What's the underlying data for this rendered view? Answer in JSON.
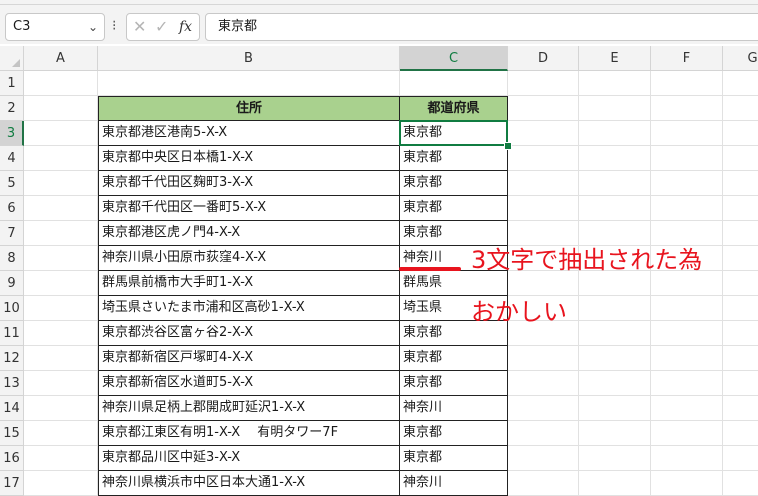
{
  "formula_bar": {
    "name_box": "C3",
    "chevron": "⌄",
    "dots": "⁝",
    "cancel_symbol": "✕",
    "enter_symbol": "✓",
    "fx_symbol": "fx",
    "formula": "東京都"
  },
  "columns": [
    "A",
    "B",
    "C",
    "D",
    "E",
    "F",
    "G"
  ],
  "rows": [
    "1",
    "2",
    "3",
    "4",
    "5",
    "6",
    "7",
    "8",
    "9",
    "10",
    "11",
    "12",
    "13",
    "14",
    "15",
    "16",
    "17"
  ],
  "table": {
    "headers": {
      "address": "住所",
      "prefecture": "都道府県"
    },
    "addresses": [
      "東京都港区港南5-X-X",
      "東京都中央区日本橋1-X-X",
      "東京都千代田区麹町3-X-X",
      "東京都千代田区一番町5-X-X",
      "東京都港区虎ノ門4-X-X",
      "神奈川県小田原市荻窪4-X-X",
      "群馬県前橋市大手町1-X-X",
      "埼玉県さいたま市浦和区高砂1-X-X",
      "東京都渋谷区富ヶ谷2-X-X",
      "東京都新宿区戸塚町4-X-X",
      "東京都新宿区水道町5-X-X",
      "神奈川県足柄上郡開成町延沢1-X-X",
      "東京都江東区有明1-X-X　 有明タワー7F",
      "東京都品川区中延3-X-X",
      "神奈川県横浜市中区日本大通1-X-X"
    ],
    "prefectures": [
      "東京都",
      "東京都",
      "東京都",
      "東京都",
      "東京都",
      "神奈川",
      "群馬県",
      "埼玉県",
      "東京都",
      "東京都",
      "東京都",
      "神奈川",
      "東京都",
      "東京都",
      "神奈川"
    ]
  },
  "annotation": {
    "line1": "3文字で抽出された為",
    "line2": "おかしい",
    "color": "#e8141e"
  },
  "colors": {
    "header_fill": "#a9d18e",
    "selection_green": "#107c41"
  }
}
